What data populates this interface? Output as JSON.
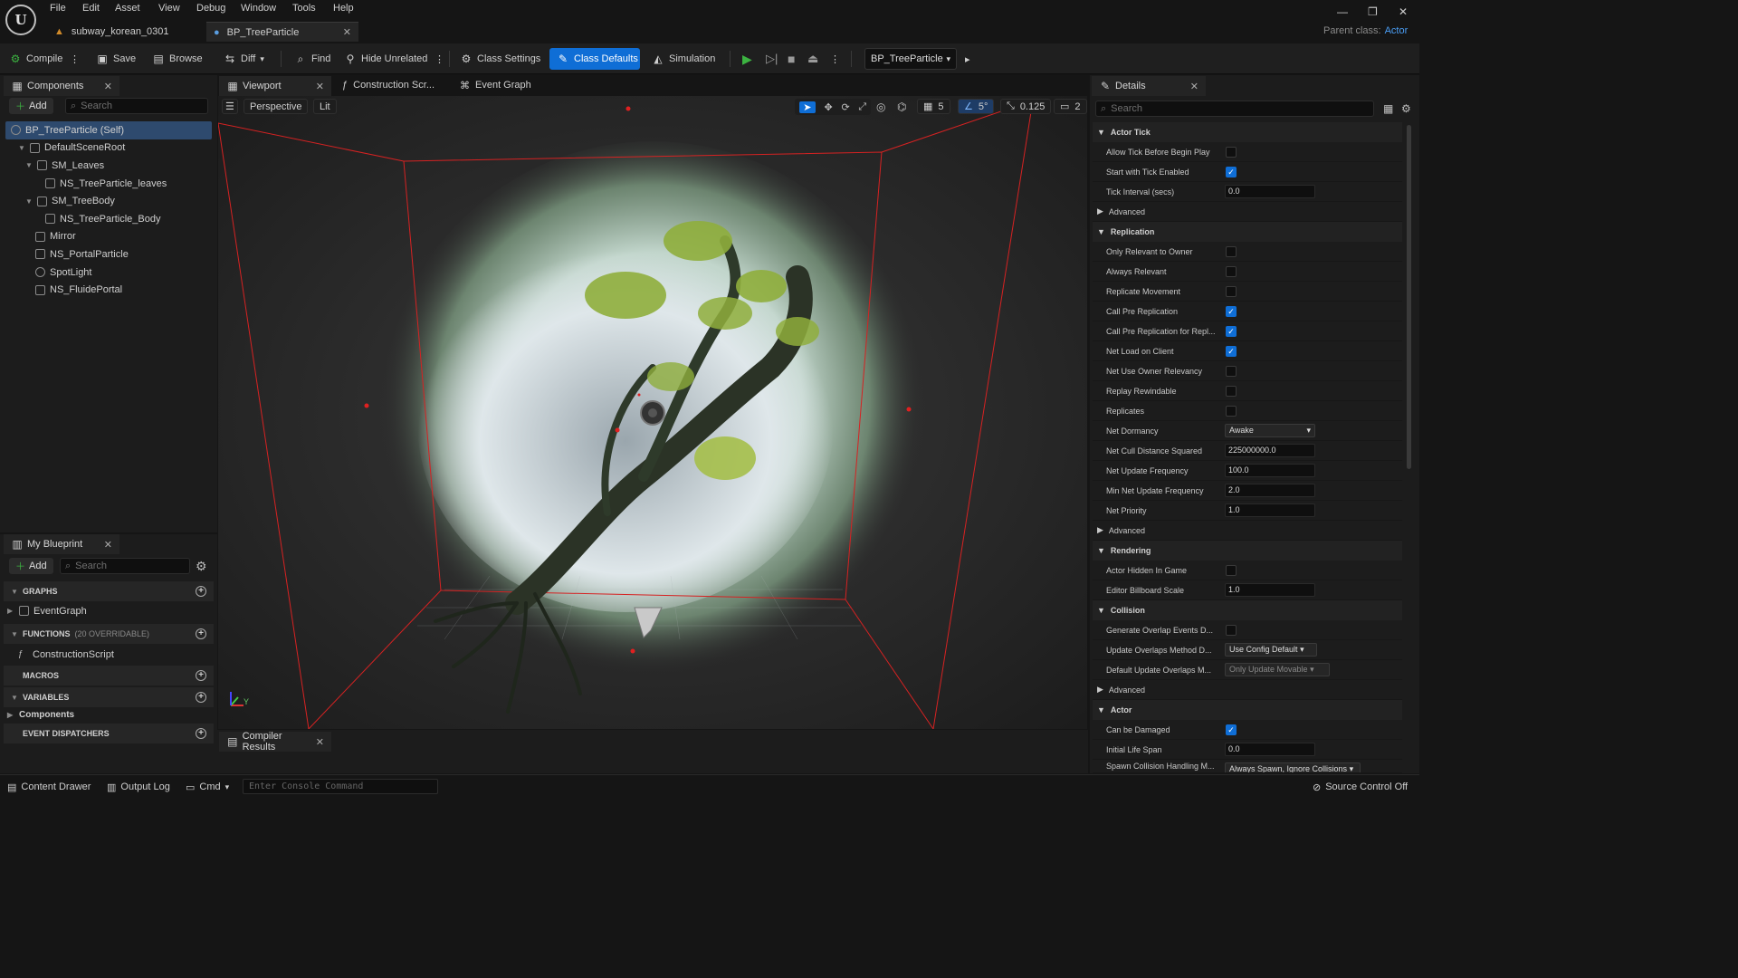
{
  "menu": [
    "File",
    "Edit",
    "Asset",
    "View",
    "Debug",
    "Window",
    "Tools",
    "Help"
  ],
  "doc_tabs": [
    {
      "label": "subway_korean_0301"
    },
    {
      "label": "BP_TreeParticle"
    }
  ],
  "parent_class": {
    "label": "Parent class:",
    "value": "Actor"
  },
  "toolbar": {
    "compile": "Compile",
    "save": "Save",
    "browse": "Browse",
    "diff": "Diff",
    "find": "Find",
    "hide_unrelated": "Hide Unrelated",
    "class_settings": "Class Settings",
    "class_defaults": "Class Defaults",
    "simulation": "Simulation",
    "blueprint_dropdown": "BP_TreeParticle"
  },
  "components": {
    "tab": "Components",
    "add": "Add",
    "search_placeholder": "Search",
    "tree": [
      "BP_TreeParticle (Self)",
      "DefaultSceneRoot",
      "SM_Leaves",
      "NS_TreeParticle_leaves",
      "SM_TreeBody",
      "NS_TreeParticle_Body",
      "Mirror",
      "NS_PortalParticle",
      "SpotLight",
      "NS_FluidePortal"
    ]
  },
  "my_blueprint": {
    "tab": "My Blueprint",
    "add": "Add",
    "search_placeholder": "Search",
    "graphs": "GRAPHS",
    "event_graph": "EventGraph",
    "functions": "FUNCTIONS",
    "functions_count": "(20 OVERRIDABLE)",
    "construction_script": "ConstructionScript",
    "macros": "MACROS",
    "variables": "VARIABLES",
    "components": "Components",
    "event_dispatchers": "EVENT DISPATCHERS"
  },
  "editor_tabs": {
    "viewport": "Viewport",
    "construction": "Construction Scr...",
    "event_graph": "Event Graph"
  },
  "viewport": {
    "perspective": "Perspective",
    "lit": "Lit",
    "grid_snap": "5",
    "rot_snap": "5°",
    "scale_snap": "0.125",
    "cam_speed": "2"
  },
  "compiler": {
    "tab": "Compiler Results"
  },
  "details": {
    "tab": "Details",
    "search_placeholder": "Search",
    "actor_tick": {
      "title": "Actor Tick",
      "allow_tick": "Allow Tick Before Begin Play",
      "start_tick": "Start with Tick Enabled",
      "tick_interval": "Tick Interval (secs)",
      "tick_interval_val": "0.0",
      "advanced": "Advanced"
    },
    "replication": {
      "title": "Replication",
      "only_relevant": "Only Relevant to Owner",
      "always_relevant": "Always Relevant",
      "replicate_movement": "Replicate Movement",
      "call_pre": "Call Pre Replication",
      "call_pre_repl": "Call Pre Replication for Repl...",
      "net_load": "Net Load on Client",
      "net_owner": "Net Use Owner Relevancy",
      "replay": "Replay Rewindable",
      "replicates": "Replicates",
      "net_dormancy": "Net Dormancy",
      "net_dormancy_val": "Awake",
      "net_cull": "Net Cull Distance Squared",
      "net_cull_val": "225000000.0",
      "net_update": "Net Update Frequency",
      "net_update_val": "100.0",
      "min_net": "Min Net Update Frequency",
      "min_net_val": "2.0",
      "net_priority": "Net Priority",
      "net_priority_val": "1.0",
      "advanced": "Advanced"
    },
    "rendering": {
      "title": "Rendering",
      "hidden": "Actor Hidden In Game",
      "billboard": "Editor Billboard Scale",
      "billboard_val": "1.0"
    },
    "collision": {
      "title": "Collision",
      "gen_overlap": "Generate Overlap Events D...",
      "update_method": "Update Overlaps Method D...",
      "update_method_val": "Use Config Default",
      "default_update": "Default Update Overlaps M...",
      "default_update_val": "Only Update Movable",
      "advanced": "Advanced"
    },
    "actor": {
      "title": "Actor",
      "can_damage": "Can be Damaged",
      "life_span": "Initial Life Span",
      "life_span_val": "0.0",
      "spawn": "Spawn Collision Handling M...",
      "spawn_val": "Always Spawn, Ignore Collisions"
    }
  },
  "statusbar": {
    "content_drawer": "Content Drawer",
    "output_log": "Output Log",
    "cmd": "Cmd",
    "console_placeholder": "Enter Console Command",
    "source_control": "Source Control Off"
  }
}
